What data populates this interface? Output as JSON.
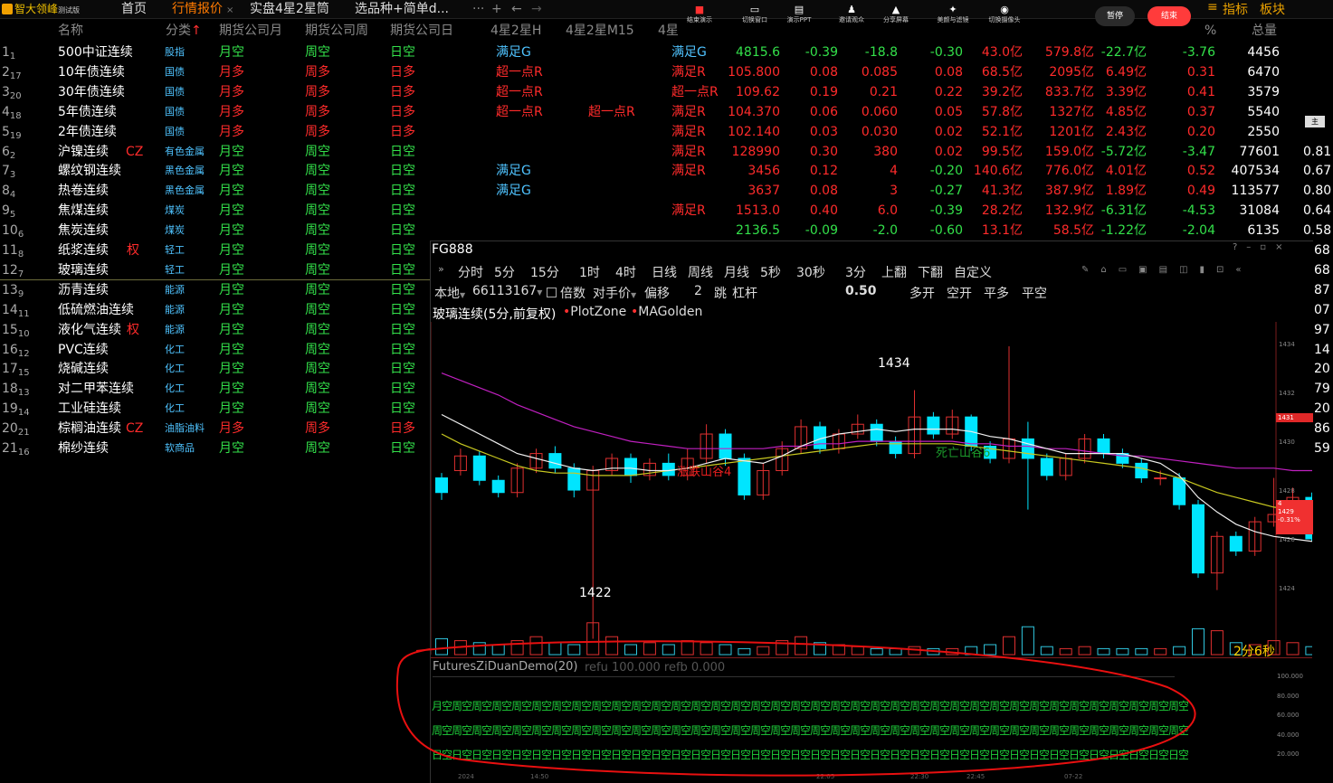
{
  "app": {
    "name": "智大领峰",
    "edition": "测试版"
  },
  "tabs": [
    "首页",
    "行情报价",
    "实盘4星2星筒",
    "选品种+简单d...",
    "···",
    "+",
    "←",
    "→"
  ],
  "toolbar_buttons": [
    {
      "icon": "stop-icon",
      "label": "结束演示"
    },
    {
      "icon": "window-icon",
      "label": "切换窗口"
    },
    {
      "icon": "ppt-icon",
      "label": "演示PPT"
    },
    {
      "icon": "person-icon",
      "label": "邀请观众"
    },
    {
      "icon": "share-icon",
      "label": "分享屏幕"
    },
    {
      "icon": "magic-icon",
      "label": "美颜与滤镜"
    },
    {
      "icon": "camera-icon",
      "label": "切换摄像头"
    }
  ],
  "pause_label": "暂停",
  "end_label": "结束",
  "right_menu": [
    "指标",
    "板块"
  ],
  "columns": [
    "名称",
    "分类",
    "期货公司月",
    "期货公司周",
    "期货公司日",
    "4星2星H",
    "4星2星M15",
    "4星",
    "%",
    "总量"
  ],
  "rows": [
    {
      "n": "1",
      "s": "1",
      "name": "500中证连续",
      "tag": "",
      "cat": "股指",
      "m": "月空",
      "mc": "g",
      "wk": "周空",
      "wc": "g",
      "d": "日空",
      "dc": "g",
      "h": "满足G",
      "hc": "c",
      "m15": "",
      "m4": "满足G",
      "m4c": "c",
      "price": "4815.6",
      "chg": "-0.39",
      "chg2": "-18.8",
      "pct": "-0.30",
      "v1": "43.0亿",
      "v2": "579.8亿",
      "v3": "-22.7亿",
      "v4": "-3.76",
      "vol": "4456",
      "extra": ""
    },
    {
      "n": "2",
      "s": "17",
      "name": "10年债连续",
      "tag": "",
      "cat": "国债",
      "m": "月多",
      "mc": "r",
      "wk": "周多",
      "wc": "r",
      "d": "日多",
      "dc": "r",
      "h": "超一点R",
      "hc": "r",
      "m15": "",
      "m4": "满足R",
      "m4c": "r",
      "price": "105.800",
      "chg": "0.08",
      "chg2": "0.085",
      "pct": "0.08",
      "v1": "68.5亿",
      "v2": "2095亿",
      "v3": "6.49亿",
      "v4": "0.31",
      "vol": "6470",
      "extra": ""
    },
    {
      "n": "3",
      "s": "20",
      "name": "30年债连续",
      "tag": "",
      "cat": "国债",
      "m": "月多",
      "mc": "r",
      "wk": "周多",
      "wc": "r",
      "d": "日多",
      "dc": "r",
      "h": "超一点R",
      "hc": "r",
      "m15": "",
      "m4": "超一点R",
      "m4c": "r",
      "price": "109.62",
      "chg": "0.19",
      "chg2": "0.21",
      "pct": "0.22",
      "v1": "39.2亿",
      "v2": "833.7亿",
      "v3": "3.39亿",
      "v4": "0.41",
      "vol": "3579",
      "extra": ""
    },
    {
      "n": "4",
      "s": "18",
      "name": "5年债连续",
      "tag": "",
      "cat": "国债",
      "m": "月多",
      "mc": "r",
      "wk": "周多",
      "wc": "r",
      "d": "日多",
      "dc": "r",
      "h": "超一点R",
      "hc": "r",
      "m15": "超一点R",
      "m4": "满足R",
      "m4c": "r",
      "price": "104.370",
      "chg": "0.06",
      "chg2": "0.060",
      "pct": "0.05",
      "v1": "57.8亿",
      "v2": "1327亿",
      "v3": "4.85亿",
      "v4": "0.37",
      "vol": "5540",
      "extra": ""
    },
    {
      "n": "5",
      "s": "19",
      "name": "2年债连续",
      "tag": "",
      "cat": "国债",
      "m": "月多",
      "mc": "r",
      "wk": "周多",
      "wc": "r",
      "d": "日多",
      "dc": "r",
      "h": "",
      "hc": "r",
      "m15": "",
      "m4": "满足R",
      "m4c": "r",
      "price": "102.140",
      "chg": "0.03",
      "chg2": "0.030",
      "pct": "0.02",
      "v1": "52.1亿",
      "v2": "1201亿",
      "v3": "2.43亿",
      "v4": "0.20",
      "vol": "2550",
      "extra": ""
    },
    {
      "n": "6",
      "s": "2",
      "name": "沪镍连续",
      "tag": "CZ",
      "cat": "有色金属",
      "m": "月空",
      "mc": "g",
      "wk": "周空",
      "wc": "g",
      "d": "日空",
      "dc": "g",
      "h": "",
      "hc": "c",
      "m15": "",
      "m4": "满足R",
      "m4c": "r",
      "price": "128990",
      "chg": "0.30",
      "chg2": "380",
      "pct": "0.02",
      "v1": "99.5亿",
      "v2": "159.0亿",
      "v3": "-5.72亿",
      "v4": "-3.47",
      "vol": "77601",
      "extra": "0.81"
    },
    {
      "n": "7",
      "s": "3",
      "name": "螺纹钢连续",
      "tag": "",
      "cat": "黑色金属",
      "m": "月空",
      "mc": "g",
      "wk": "周空",
      "wc": "g",
      "d": "日空",
      "dc": "g",
      "h": "满足G",
      "hc": "c",
      "m15": "",
      "m4": "满足R",
      "m4c": "r",
      "price": "3456",
      "chg": "0.12",
      "chg2": "4",
      "pct": "-0.20",
      "v1": "140.6亿",
      "v2": "776.0亿",
      "v3": "4.01亿",
      "v4": "0.52",
      "vol": "407534",
      "extra": "0.67"
    },
    {
      "n": "8",
      "s": "4",
      "name": "热卷连续",
      "tag": "",
      "cat": "黑色金属",
      "m": "月空",
      "mc": "g",
      "wk": "周空",
      "wc": "g",
      "d": "日空",
      "dc": "g",
      "h": "满足G",
      "hc": "c",
      "m15": "",
      "m4": "",
      "m4c": "r",
      "price": "3637",
      "chg": "0.08",
      "chg2": "3",
      "pct": "-0.27",
      "v1": "41.3亿",
      "v2": "387.9亿",
      "v3": "1.89亿",
      "v4": "0.49",
      "vol": "113577",
      "extra": "0.80"
    },
    {
      "n": "9",
      "s": "5",
      "name": "焦煤连续",
      "tag": "",
      "cat": "煤炭",
      "m": "月空",
      "mc": "g",
      "wk": "周空",
      "wc": "g",
      "d": "日空",
      "dc": "g",
      "h": "",
      "hc": "c",
      "m15": "",
      "m4": "满足R",
      "m4c": "r",
      "price": "1513.0",
      "chg": "0.40",
      "chg2": "6.0",
      "pct": "-0.39",
      "v1": "28.2亿",
      "v2": "132.9亿",
      "v3": "-6.31亿",
      "v4": "-4.53",
      "vol": "31084",
      "extra": "0.64"
    },
    {
      "n": "10",
      "s": "6",
      "name": "焦炭连续",
      "tag": "",
      "cat": "煤炭",
      "m": "月空",
      "mc": "g",
      "wk": "周空",
      "wc": "g",
      "d": "日空",
      "dc": "g",
      "h": "",
      "hc": "c",
      "m15": "",
      "m4": "",
      "m4c": "r",
      "price": "2136.5",
      "chg": "-0.09",
      "chg2": "-2.0",
      "pct": "-0.60",
      "v1": "13.1亿",
      "v2": "58.5亿",
      "v3": "-1.22亿",
      "v4": "-2.04",
      "vol": "6135",
      "extra": "0.58"
    },
    {
      "n": "11",
      "s": "8",
      "name": "纸浆连续",
      "tag": "权",
      "cat": "轻工",
      "m": "月空",
      "mc": "g",
      "wk": "周空",
      "wc": "g",
      "d": "日空",
      "dc": "g",
      "extra": "68"
    },
    {
      "n": "12",
      "s": "7",
      "name": "玻璃连续",
      "tag": "",
      "cat": "轻工",
      "m": "月空",
      "mc": "g",
      "wk": "周空",
      "wc": "g",
      "d": "日空",
      "dc": "g",
      "extra": "68"
    },
    {
      "n": "13",
      "s": "9",
      "name": "沥青连续",
      "tag": "",
      "cat": "能源",
      "m": "月空",
      "mc": "g",
      "wk": "周空",
      "wc": "g",
      "d": "日空",
      "dc": "g",
      "extra": "87"
    },
    {
      "n": "14",
      "s": "11",
      "name": "低硫燃油连续",
      "tag": "",
      "cat": "能源",
      "m": "月空",
      "mc": "g",
      "wk": "周空",
      "wc": "g",
      "d": "日空",
      "dc": "g",
      "extra": "07"
    },
    {
      "n": "15",
      "s": "10",
      "name": "液化气连续",
      "tag": "权",
      "cat": "能源",
      "m": "月空",
      "mc": "g",
      "wk": "周空",
      "wc": "g",
      "d": "日空",
      "dc": "g",
      "extra": "97"
    },
    {
      "n": "16",
      "s": "12",
      "name": "PVC连续",
      "tag": "",
      "cat": "化工",
      "m": "月空",
      "mc": "g",
      "wk": "周空",
      "wc": "g",
      "d": "日空",
      "dc": "g",
      "extra": "14"
    },
    {
      "n": "17",
      "s": "15",
      "name": "烧碱连续",
      "tag": "",
      "cat": "化工",
      "m": "月空",
      "mc": "g",
      "wk": "周空",
      "wc": "g",
      "d": "日空",
      "dc": "g",
      "extra": "20"
    },
    {
      "n": "18",
      "s": "13",
      "name": "对二甲苯连续",
      "tag": "",
      "cat": "化工",
      "m": "月空",
      "mc": "g",
      "wk": "周空",
      "wc": "g",
      "d": "日空",
      "dc": "g",
      "extra": "79"
    },
    {
      "n": "19",
      "s": "14",
      "name": "工业硅连续",
      "tag": "",
      "cat": "化工",
      "m": "月空",
      "mc": "g",
      "wk": "周空",
      "wc": "g",
      "d": "日空",
      "dc": "g",
      "extra": "20"
    },
    {
      "n": "20",
      "s": "21",
      "name": "棕榈油连续",
      "tag": "CZ",
      "cat": "油脂油料",
      "m": "月多",
      "mc": "r",
      "wk": "周多",
      "wc": "r",
      "d": "日多",
      "dc": "r",
      "extra": "86"
    },
    {
      "n": "21",
      "s": "16",
      "name": "棉纱连续",
      "tag": "",
      "cat": "软商品",
      "m": "月空",
      "mc": "g",
      "wk": "周空",
      "wc": "g",
      "d": "日空",
      "dc": "g",
      "extra": "59"
    }
  ],
  "chart": {
    "symbol": "FG888",
    "periods": [
      "分时",
      "5分",
      "15分",
      "1时",
      "4时",
      "日线",
      "周线",
      "月线",
      "5秒",
      "30秒",
      "3分",
      "上翻",
      "下翻",
      "自定义"
    ],
    "account": "本地",
    "account_no": "66113167",
    "order_labels": [
      "倍数",
      "对手价",
      "偏移",
      "2",
      "跳",
      "杠杆"
    ],
    "lot": "0.50",
    "actions": [
      "多开",
      "空开",
      "平多",
      "平空"
    ],
    "title": "玻璃连续(5分,前复权)",
    "indicators": [
      "PlotZone",
      "MAGolden"
    ],
    "high_label": "1434",
    "low_label": "1422",
    "ann1": "涨跌山谷4",
    "ann2": "死亡山谷6",
    "countdown": "2分6秒",
    "yticks": [
      "1434",
      "1432",
      "1430",
      "1428",
      "1426",
      "1424"
    ],
    "price_tag": [
      "1431",
      "4",
      "1429",
      "-0.31%"
    ],
    "ind_title": "FuturesZiDuanDemo(20)",
    "ind_params": "refu 100.000 refb 0.000",
    "ind_yticks": [
      "100.000",
      "80.000",
      "60.000",
      "40.000",
      "20.000"
    ],
    "ind_rows": [
      "月空周空周空周空周空周空周空周空周空周空周空周空周空周空周空周空周空周空周空周空周空周空周空周空周空周空周空周空周空周空周空周空周空周空周空周空周空周空周空周空周空周空周空周空周空周空",
      "周空周空周空周空周空周空周空周空周空周空周空周空周空周空周空周空周空周空周空周空周空周空周空周空周空周空周空周空周空周空周空周空周空周空周空周空周空周空周空周空周空周空周空周空周空周空",
      "日空日空日空日空日空日空日空日空日空日空日空日空日空日空日空日空日空日空日空日空日空日空日空日空日空日空日空日空日空日空日空日空日空日空日空日空日空日空日空日空日空日空日空日空日空日空日空"
    ],
    "xticks": [
      "2024",
      "14:50",
      "22:05",
      "22:30",
      "22:45",
      "07-22"
    ],
    "candles": [
      [
        1428.6,
        1428.0,
        1428.8,
        1427.7
      ],
      [
        1428.9,
        1429.5,
        1429.8,
        1428.7
      ],
      [
        1429.5,
        1428.5,
        1429.7,
        1428.3
      ],
      [
        1428.5,
        1428.0,
        1428.7,
        1427.8
      ],
      [
        1428.0,
        1429.0,
        1429.2,
        1427.8
      ],
      [
        1429.0,
        1429.6,
        1429.8,
        1428.8
      ],
      [
        1429.6,
        1429.0,
        1429.9,
        1428.8
      ],
      [
        1429.0,
        1428.1,
        1429.2,
        1427.8
      ],
      [
        1428.1,
        1428.9,
        1429.1,
        1422.0
      ],
      [
        1428.9,
        1429.4,
        1429.6,
        1428.7
      ],
      [
        1429.4,
        1428.7,
        1429.6,
        1428.4
      ],
      [
        1428.7,
        1429.2,
        1429.4,
        1428.5
      ],
      [
        1429.2,
        1428.7,
        1429.6,
        1428.5
      ],
      [
        1428.7,
        1429.4,
        1429.8,
        1428.5
      ],
      [
        1429.4,
        1430.4,
        1430.8,
        1429.2
      ],
      [
        1430.4,
        1429.4,
        1430.6,
        1429.1
      ],
      [
        1429.4,
        1427.9,
        1429.6,
        1427.7
      ],
      [
        1427.9,
        1428.9,
        1429.2,
        1427.7
      ],
      [
        1428.9,
        1429.8,
        1430.1,
        1428.7
      ],
      [
        1429.8,
        1430.7,
        1431.0,
        1429.6
      ],
      [
        1430.7,
        1429.8,
        1430.9,
        1429.6
      ],
      [
        1429.8,
        1430.4,
        1430.6,
        1429.6
      ],
      [
        1430.4,
        1430.8,
        1431.2,
        1430.2
      ],
      [
        1430.8,
        1430.1,
        1431.0,
        1429.9
      ],
      [
        1430.1,
        1429.6,
        1430.3,
        1429.4
      ],
      [
        1429.6,
        1431.1,
        1432.2,
        1429.4
      ],
      [
        1431.1,
        1430.4,
        1431.3,
        1430.2
      ],
      [
        1430.4,
        1431.1,
        1431.4,
        1430.2
      ],
      [
        1431.1,
        1429.9,
        1431.2,
        1429.7
      ],
      [
        1429.9,
        1429.4,
        1430.1,
        1429.2
      ],
      [
        1429.4,
        1430.2,
        1434.0,
        1429.2
      ],
      [
        1430.2,
        1429.4,
        1430.9,
        1427.3
      ],
      [
        1429.4,
        1428.7,
        1429.6,
        1428.5
      ],
      [
        1428.7,
        1429.4,
        1429.6,
        1428.5
      ],
      [
        1429.4,
        1430.2,
        1430.4,
        1429.2
      ],
      [
        1430.2,
        1429.6,
        1430.4,
        1429.4
      ],
      [
        1429.6,
        1429.2,
        1429.8,
        1429.0
      ],
      [
        1429.2,
        1428.6,
        1429.4,
        1428.4
      ],
      [
        1428.6,
        1428.6,
        1428.9,
        1428.3
      ],
      [
        1428.6,
        1427.5,
        1428.8,
        1427.3
      ],
      [
        1427.5,
        1424.7,
        1427.7,
        1424.5
      ],
      [
        1424.7,
        1426.2,
        1426.4,
        1424.0
      ],
      [
        1426.2,
        1425.6,
        1426.4,
        1425.4
      ],
      [
        1425.6,
        1426.8,
        1427.0,
        1425.4
      ],
      [
        1426.8,
        1427.1,
        1428.6,
        1426.6
      ],
      [
        1427.1,
        1427.8,
        1428.2,
        1427.0
      ],
      [
        1427.8,
        1426.1,
        1428.0,
        1426.0
      ],
      [
        1426.1,
        1429.0,
        1429.6,
        1425.9
      ],
      [
        1429.0,
        1430.9,
        1431.2,
        1428.8
      ],
      [
        1430.9,
        1431.6,
        1433.3,
        1430.7
      ],
      [
        1433.3,
        1431.4,
        1433.4,
        1431.2
      ],
      [
        1430.8,
        1431.4,
        1432.0,
        1430.6
      ]
    ],
    "ma_white": [
      1431.2,
      1430.8,
      1430.4,
      1430.0,
      1429.6,
      1429.4,
      1429.2,
      1429.0,
      1428.9,
      1429.0,
      1429.0,
      1428.9,
      1428.9,
      1429.0,
      1429.2,
      1429.4,
      1429.3,
      1429.2,
      1429.5,
      1429.9,
      1430.2,
      1430.4,
      1430.5,
      1430.6,
      1430.5,
      1430.6,
      1430.6,
      1430.6,
      1430.5,
      1430.3,
      1430.2,
      1430.0,
      1429.8,
      1429.6,
      1429.6,
      1429.6,
      1429.6,
      1429.4,
      1429.2,
      1428.7,
      1427.8,
      1427.2,
      1426.7,
      1426.4,
      1426.2,
      1426.1,
      1426.0,
      1426.5,
      1427.5,
      1428.6,
      1429.6,
      1430.2
    ],
    "ma_yellow": [
      1430.4,
      1430.0,
      1429.7,
      1429.4,
      1429.1,
      1428.9,
      1428.8,
      1428.8,
      1428.7,
      1428.7,
      1428.7,
      1428.8,
      1428.9,
      1429.0,
      1429.1,
      1429.2,
      1429.3,
      1429.4,
      1429.5,
      1429.6,
      1429.7,
      1429.8,
      1429.9,
      1430.0,
      1430.0,
      1430.0,
      1430.0,
      1430.0,
      1429.9,
      1429.8,
      1429.7,
      1429.6,
      1429.5,
      1429.4,
      1429.3,
      1429.2,
      1429.1,
      1429.0,
      1428.8,
      1428.6,
      1428.3,
      1428.0,
      1427.8,
      1427.6,
      1427.4,
      1427.3,
      1427.3,
      1427.4,
      1427.6,
      1427.9,
      1428.2,
      1428.5
    ],
    "ma_magenta": [
      1432.9,
      1432.6,
      1432.3,
      1432.0,
      1431.6,
      1431.3,
      1431.0,
      1430.7,
      1430.5,
      1430.3,
      1430.1,
      1430.0,
      1429.9,
      1429.8,
      1429.8,
      1429.8,
      1429.8,
      1429.8,
      1429.9,
      1429.9,
      1430.0,
      1430.0,
      1430.1,
      1430.1,
      1430.1,
      1430.1,
      1430.1,
      1430.1,
      1430.0,
      1430.0,
      1429.9,
      1429.9,
      1429.8,
      1429.8,
      1429.7,
      1429.6,
      1429.5,
      1429.5,
      1429.4,
      1429.3,
      1429.2,
      1429.1,
      1429.0,
      1429.0,
      1429.0,
      1428.9,
      1428.9,
      1428.9,
      1428.9,
      1428.9,
      1429.0,
      1429.0
    ],
    "volumes": [
      0.8,
      0.7,
      0.6,
      0.5,
      0.7,
      0.9,
      0.6,
      0.5,
      1.6,
      0.9,
      0.5,
      0.6,
      0.5,
      0.7,
      0.6,
      0.5,
      0.3,
      0.4,
      0.7,
      0.9,
      0.6,
      0.5,
      0.4,
      0.3,
      0.3,
      0.4,
      0.3,
      0.3,
      0.4,
      0.5,
      0.9,
      1.4,
      0.4,
      0.3,
      0.4,
      0.3,
      0.3,
      0.3,
      0.3,
      0.4,
      1.3,
      1.2,
      0.6,
      0.5,
      0.7,
      0.6,
      0.4,
      0.6,
      0.9,
      1.1,
      0.8,
      0.5
    ]
  }
}
